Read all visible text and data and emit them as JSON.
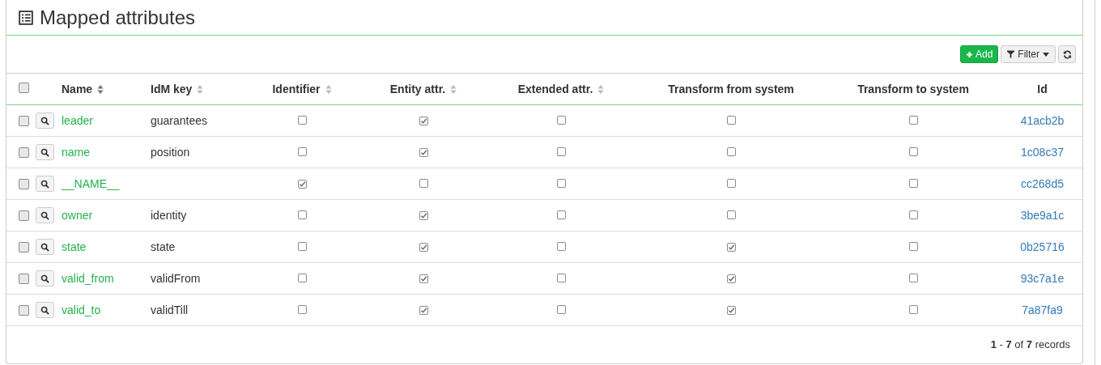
{
  "title": "Mapped attributes",
  "toolbar": {
    "add": "Add",
    "filter": "Filter"
  },
  "table": {
    "select_all": {
      "checked": false
    },
    "columns": [
      {
        "label": "Name",
        "sortable": true,
        "sorted": true
      },
      {
        "label": "IdM key",
        "sortable": true,
        "sorted": false
      },
      {
        "label": "Identifier",
        "sortable": true,
        "sorted": false
      },
      {
        "label": "Entity attr.",
        "sortable": true,
        "sorted": false
      },
      {
        "label": "Extended attr.",
        "sortable": true,
        "sorted": false
      },
      {
        "label": "Transform from system",
        "sortable": false
      },
      {
        "label": "Transform to system",
        "sortable": false
      },
      {
        "label": "Id",
        "sortable": false
      }
    ],
    "rows": [
      {
        "selected": false,
        "name": "leader",
        "idm_key": "guarantees",
        "identifier": false,
        "entity": true,
        "extended": false,
        "transform_from": false,
        "transform_to": false,
        "id": "41acb2b"
      },
      {
        "selected": false,
        "name": "name",
        "idm_key": "position",
        "identifier": false,
        "entity": true,
        "extended": false,
        "transform_from": false,
        "transform_to": false,
        "id": "1c08c37"
      },
      {
        "selected": false,
        "name": "__NAME__",
        "identifier": true,
        "entity": false,
        "extended": false,
        "transform_from": false,
        "transform_to": false,
        "id": "cc268d5"
      },
      {
        "selected": false,
        "name": "owner",
        "idm_key": "identity",
        "identifier": false,
        "entity": true,
        "extended": false,
        "transform_from": false,
        "transform_to": false,
        "id": "3be9a1c"
      },
      {
        "selected": false,
        "name": "state",
        "idm_key": "state",
        "identifier": false,
        "entity": true,
        "extended": false,
        "transform_from": true,
        "transform_to": false,
        "id": "0b25716"
      },
      {
        "selected": false,
        "name": "valid_from",
        "idm_key": "validFrom",
        "identifier": false,
        "entity": true,
        "extended": false,
        "transform_from": true,
        "transform_to": false,
        "id": "93c7a1e"
      },
      {
        "selected": false,
        "name": "valid_to",
        "idm_key": "validTill",
        "identifier": false,
        "entity": true,
        "extended": false,
        "transform_from": true,
        "transform_to": false,
        "id": "7a87fa9"
      }
    ]
  },
  "footer": "**1** - **7** of **7** records"
}
